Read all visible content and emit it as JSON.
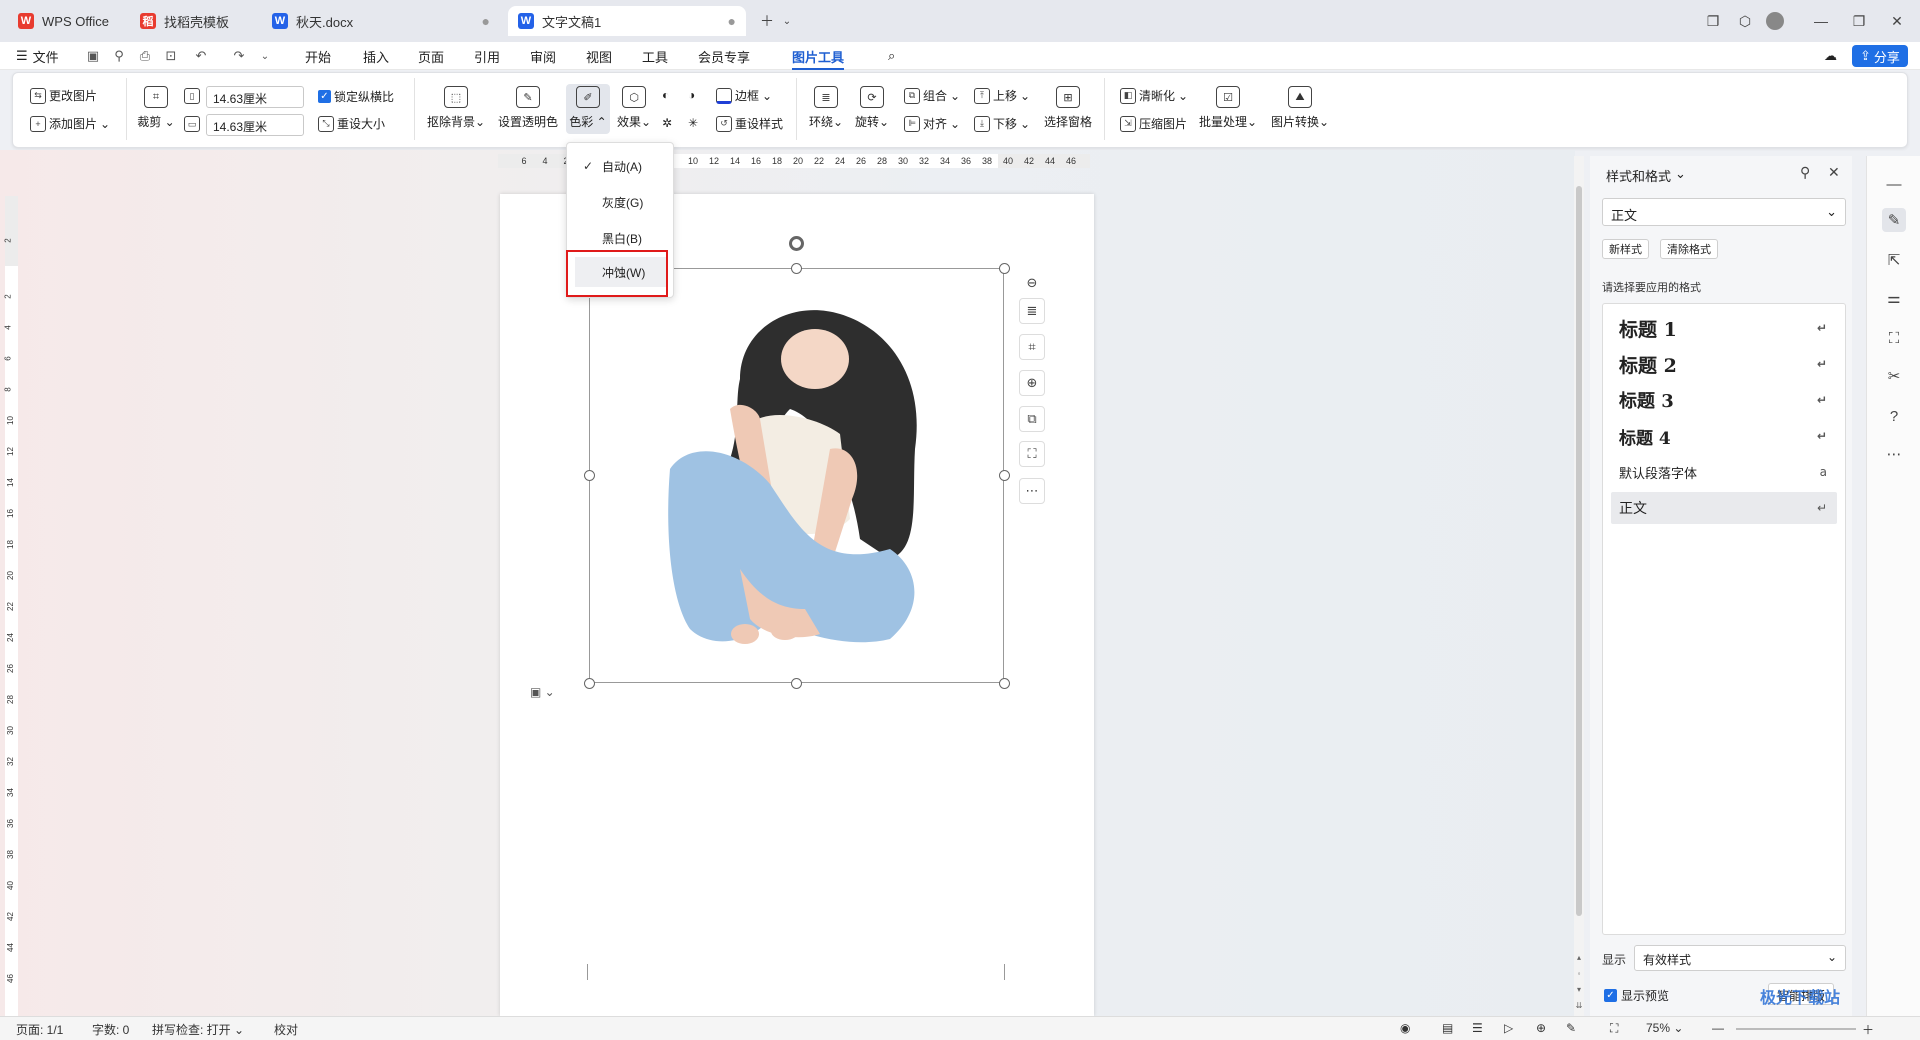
{
  "tabs": [
    {
      "badge": "W",
      "badge_color": "#e83b2f",
      "label": "WPS Office"
    },
    {
      "badge": "稻",
      "badge_color": "#e83b2f",
      "label": "找稻壳模板"
    },
    {
      "badge": "W",
      "badge_color": "#2462e8",
      "label": "秋天.docx"
    },
    {
      "badge": "W",
      "badge_color": "#2462e8",
      "label": "文字文稿1"
    }
  ],
  "menu": {
    "file": "文件",
    "items": [
      "开始",
      "插入",
      "页面",
      "引用",
      "审阅",
      "视图",
      "工具",
      "会员专享",
      "图片工具"
    ],
    "share": "分享"
  },
  "ribbon": {
    "change_image": "更改图片",
    "add_image": "添加图片",
    "crop": "裁剪",
    "width": "14.63厘米",
    "height": "14.63厘米",
    "lock_ratio": "锁定纵横比",
    "reset_size": "重设大小",
    "remove_bg": "抠除背景",
    "set_transparent": "设置透明色",
    "color": "色彩",
    "effect": "效果",
    "border": "边框",
    "reset_style": "重设样式",
    "wrap": "环绕",
    "rotate": "旋转",
    "group": "组合",
    "align": "对齐",
    "bring_forward": "上移",
    "send_backward": "下移",
    "selection_pane": "选择窗格",
    "sharpen": "清晰化",
    "compress": "压缩图片",
    "batch": "批量处理",
    "convert": "图片转换"
  },
  "ruler": {
    "h": [
      "6",
      "4",
      "2",
      "10",
      "12",
      "14",
      "16",
      "18",
      "20",
      "22",
      "24",
      "26",
      "28",
      "30",
      "32",
      "34",
      "36",
      "38",
      "40",
      "42",
      "44",
      "46"
    ],
    "v": [
      "2",
      "2",
      "4",
      "6",
      "8",
      "10",
      "12",
      "14",
      "16",
      "18",
      "20",
      "22",
      "24",
      "26",
      "28",
      "30",
      "32",
      "34",
      "36",
      "38",
      "40",
      "42",
      "44",
      "46"
    ]
  },
  "color_menu": [
    {
      "label": "自动(A)",
      "checked": "✓"
    },
    {
      "label": "灰度(G)",
      "checked": ""
    },
    {
      "label": "黑白(B)",
      "checked": ""
    },
    {
      "label": "冲蚀(W)",
      "checked": ""
    }
  ],
  "pane": {
    "title": "样式和格式",
    "current": "正文",
    "new_style": "新样式",
    "clear_format": "清除格式",
    "hint": "请选择要应用的格式",
    "styles": [
      {
        "label": "标题  1",
        "sym": "↵"
      },
      {
        "label": "标题  2",
        "sym": "↵"
      },
      {
        "label": "标题  3",
        "sym": "↵"
      },
      {
        "label": "标题  4",
        "sym": "↵"
      },
      {
        "label": "默认段落字体",
        "sym": "a"
      },
      {
        "label": "正文",
        "sym": "↵"
      }
    ],
    "show_label": "显示",
    "show_value": "有效样式",
    "preview": "显示预览",
    "smart": "智能排版"
  },
  "status": {
    "page": "页面: 1/1",
    "words": "字数: 0",
    "spell": "拼写检查: 打开",
    "proof": "校对",
    "zoom": "75%"
  },
  "watermark": "极光下载站"
}
